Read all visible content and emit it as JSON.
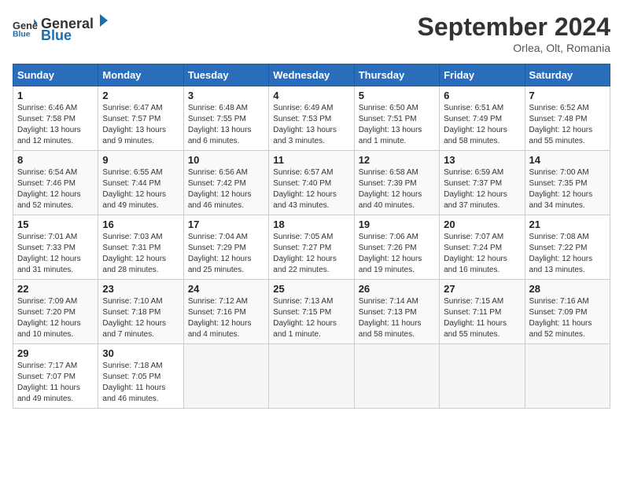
{
  "logo": {
    "general": "General",
    "blue": "Blue"
  },
  "title": "September 2024",
  "subtitle": "Orlea, Olt, Romania",
  "days_header": [
    "Sunday",
    "Monday",
    "Tuesday",
    "Wednesday",
    "Thursday",
    "Friday",
    "Saturday"
  ],
  "weeks": [
    [
      {
        "day": "1",
        "sunrise": "6:46 AM",
        "sunset": "7:58 PM",
        "daylight": "13 hours and 12 minutes."
      },
      {
        "day": "2",
        "sunrise": "6:47 AM",
        "sunset": "7:57 PM",
        "daylight": "13 hours and 9 minutes."
      },
      {
        "day": "3",
        "sunrise": "6:48 AM",
        "sunset": "7:55 PM",
        "daylight": "13 hours and 6 minutes."
      },
      {
        "day": "4",
        "sunrise": "6:49 AM",
        "sunset": "7:53 PM",
        "daylight": "13 hours and 3 minutes."
      },
      {
        "day": "5",
        "sunrise": "6:50 AM",
        "sunset": "7:51 PM",
        "daylight": "13 hours and 1 minute."
      },
      {
        "day": "6",
        "sunrise": "6:51 AM",
        "sunset": "7:49 PM",
        "daylight": "12 hours and 58 minutes."
      },
      {
        "day": "7",
        "sunrise": "6:52 AM",
        "sunset": "7:48 PM",
        "daylight": "12 hours and 55 minutes."
      }
    ],
    [
      {
        "day": "8",
        "sunrise": "6:54 AM",
        "sunset": "7:46 PM",
        "daylight": "12 hours and 52 minutes."
      },
      {
        "day": "9",
        "sunrise": "6:55 AM",
        "sunset": "7:44 PM",
        "daylight": "12 hours and 49 minutes."
      },
      {
        "day": "10",
        "sunrise": "6:56 AM",
        "sunset": "7:42 PM",
        "daylight": "12 hours and 46 minutes."
      },
      {
        "day": "11",
        "sunrise": "6:57 AM",
        "sunset": "7:40 PM",
        "daylight": "12 hours and 43 minutes."
      },
      {
        "day": "12",
        "sunrise": "6:58 AM",
        "sunset": "7:39 PM",
        "daylight": "12 hours and 40 minutes."
      },
      {
        "day": "13",
        "sunrise": "6:59 AM",
        "sunset": "7:37 PM",
        "daylight": "12 hours and 37 minutes."
      },
      {
        "day": "14",
        "sunrise": "7:00 AM",
        "sunset": "7:35 PM",
        "daylight": "12 hours and 34 minutes."
      }
    ],
    [
      {
        "day": "15",
        "sunrise": "7:01 AM",
        "sunset": "7:33 PM",
        "daylight": "12 hours and 31 minutes."
      },
      {
        "day": "16",
        "sunrise": "7:03 AM",
        "sunset": "7:31 PM",
        "daylight": "12 hours and 28 minutes."
      },
      {
        "day": "17",
        "sunrise": "7:04 AM",
        "sunset": "7:29 PM",
        "daylight": "12 hours and 25 minutes."
      },
      {
        "day": "18",
        "sunrise": "7:05 AM",
        "sunset": "7:27 PM",
        "daylight": "12 hours and 22 minutes."
      },
      {
        "day": "19",
        "sunrise": "7:06 AM",
        "sunset": "7:26 PM",
        "daylight": "12 hours and 19 minutes."
      },
      {
        "day": "20",
        "sunrise": "7:07 AM",
        "sunset": "7:24 PM",
        "daylight": "12 hours and 16 minutes."
      },
      {
        "day": "21",
        "sunrise": "7:08 AM",
        "sunset": "7:22 PM",
        "daylight": "12 hours and 13 minutes."
      }
    ],
    [
      {
        "day": "22",
        "sunrise": "7:09 AM",
        "sunset": "7:20 PM",
        "daylight": "12 hours and 10 minutes."
      },
      {
        "day": "23",
        "sunrise": "7:10 AM",
        "sunset": "7:18 PM",
        "daylight": "12 hours and 7 minutes."
      },
      {
        "day": "24",
        "sunrise": "7:12 AM",
        "sunset": "7:16 PM",
        "daylight": "12 hours and 4 minutes."
      },
      {
        "day": "25",
        "sunrise": "7:13 AM",
        "sunset": "7:15 PM",
        "daylight": "12 hours and 1 minute."
      },
      {
        "day": "26",
        "sunrise": "7:14 AM",
        "sunset": "7:13 PM",
        "daylight": "11 hours and 58 minutes."
      },
      {
        "day": "27",
        "sunrise": "7:15 AM",
        "sunset": "7:11 PM",
        "daylight": "11 hours and 55 minutes."
      },
      {
        "day": "28",
        "sunrise": "7:16 AM",
        "sunset": "7:09 PM",
        "daylight": "11 hours and 52 minutes."
      }
    ],
    [
      {
        "day": "29",
        "sunrise": "7:17 AM",
        "sunset": "7:07 PM",
        "daylight": "11 hours and 49 minutes."
      },
      {
        "day": "30",
        "sunrise": "7:18 AM",
        "sunset": "7:05 PM",
        "daylight": "11 hours and 46 minutes."
      },
      null,
      null,
      null,
      null,
      null
    ]
  ]
}
